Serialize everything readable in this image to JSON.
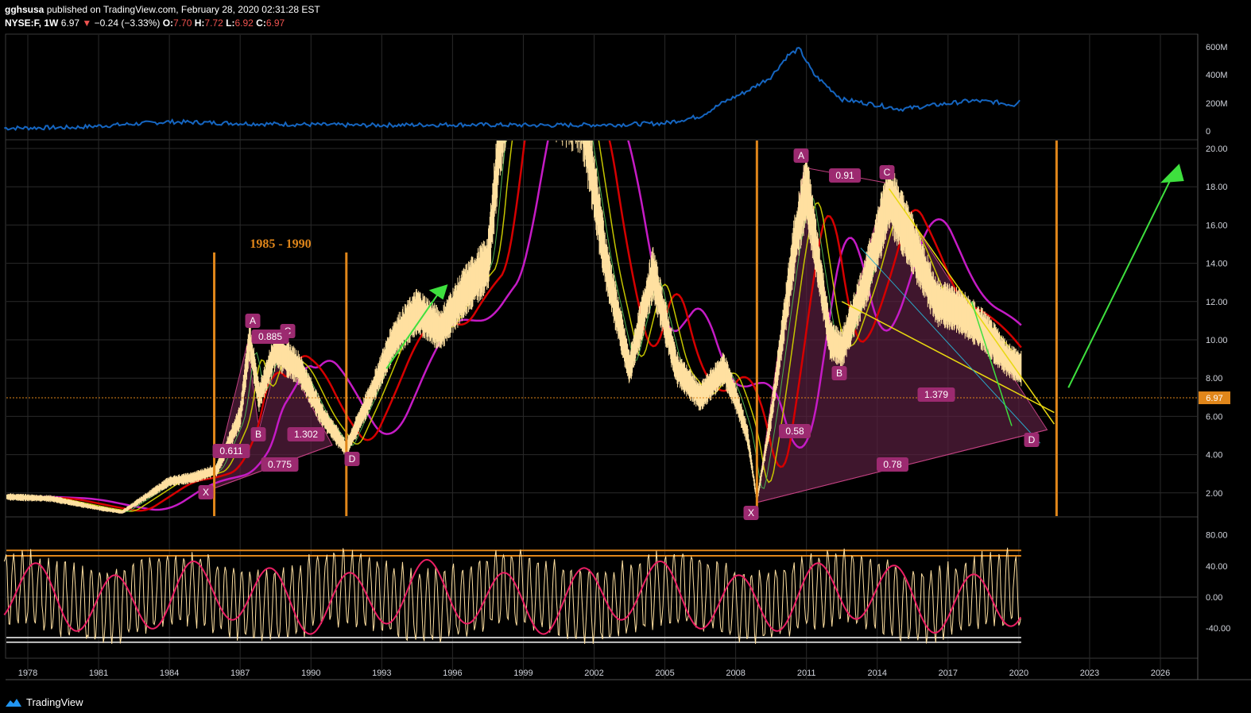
{
  "header": {
    "user": "gghsusa",
    "published": "published on TradingView.com, February 28, 2020 02:31:28 EST",
    "symbol": "NYSE:F, 1W",
    "last": "6.97",
    "change": "−0.24 (−3.33%)",
    "o_label": "O:",
    "o": "7.70",
    "h_label": "H:",
    "h": "7.72",
    "l_label": "L:",
    "l": "6.92",
    "c_label": "C:",
    "c": "6.97"
  },
  "footer": {
    "brand": "TradingView"
  },
  "colors": {
    "volume": "#1565c0",
    "ma_red": "#d50000",
    "ma_magenta": "#c51bc5",
    "ma_yellow": "#c6c600",
    "ma_green": "#4caf50",
    "candle": "#ffe0a0",
    "grid": "#2a2a2a",
    "orange": "#e0861a",
    "pattern_fill": "#5a2040",
    "label_bg": "#9c2a70",
    "osc_fast": "#ffe0a0",
    "osc_slow": "#e91e63",
    "arrow": "#3ee03e",
    "price_line": "#e0861a",
    "trend_yellow": "#e8d810",
    "trend_cyan": "#2aa8c8"
  },
  "chart_data": [
    {
      "type": "area",
      "name": "volume-pane",
      "y_ticks": [
        "600M",
        "400M",
        "200M",
        "0"
      ],
      "ylim": [
        0,
        620
      ],
      "unit": "M",
      "x": [
        1977,
        1980,
        1984,
        1988,
        1992,
        1996,
        2000,
        2003,
        2005,
        2006.5,
        2007.5,
        2008.5,
        2009.5,
        2010.2,
        2010.7,
        2011.3,
        2012.5,
        2014,
        2015,
        2016,
        2017,
        2018,
        2019,
        2019.8,
        2020.1
      ],
      "values": [
        15,
        20,
        60,
        45,
        35,
        40,
        35,
        40,
        50,
        100,
        200,
        280,
        380,
        530,
        580,
        400,
        220,
        180,
        150,
        170,
        190,
        210,
        200,
        180,
        230
      ]
    },
    {
      "type": "line",
      "name": "price-pane",
      "y_ticks": [
        "20.00",
        "18.00",
        "16.00",
        "14.00",
        "12.00",
        "10.00",
        "8.00",
        "6.00",
        "4.00",
        "2.00"
      ],
      "x_ticks": [
        "1978",
        "1981",
        "1984",
        "1987",
        "1990",
        "1993",
        "1996",
        "1999",
        "2002",
        "2005",
        "2008",
        "2011",
        "2014",
        "2017",
        "2020",
        "2023",
        "2026"
      ],
      "ylim": [
        0.2,
        20.5
      ],
      "xlim": [
        1977.1,
        2027.6
      ],
      "last_price": "6.97",
      "series": [
        {
          "x": [
            1977,
            1979,
            1981,
            1982,
            1983,
            1984,
            1985,
            1986,
            1987,
            1987.4,
            1987.8,
            1988.5,
            1989.5,
            1990.5,
            1991.5,
            1992.5,
            1993.5,
            1994.5,
            1995.5,
            1996.5,
            1997.5,
            1998,
            1998.5,
            2001.5,
            2002,
            2002.5,
            2003.5,
            2004.5,
            2005.5,
            2006.5,
            2007.5,
            2008,
            2008.5,
            2008.9,
            2009.5,
            2010.5,
            2011,
            2011.5,
            2012,
            2012.5,
            2013.5,
            2014.5,
            2015.5,
            2016.5,
            2017.5,
            2018.5,
            2019.5,
            2020.1
          ],
          "values": [
            1.8,
            1.7,
            1.2,
            1.0,
            1.8,
            2.6,
            2.8,
            3.2,
            6.0,
            10.0,
            7.0,
            9.5,
            8.5,
            6.0,
            4.3,
            7.0,
            10.0,
            11.5,
            10.5,
            12.5,
            14.0,
            20.5,
            24.0,
            22.0,
            18.0,
            14.0,
            8.5,
            13.5,
            8.5,
            7.0,
            8.5,
            7.0,
            5.0,
            1.6,
            6.0,
            15.0,
            18.0,
            14.0,
            10.0,
            9.5,
            13.0,
            17.5,
            15.0,
            12.0,
            11.5,
            10.5,
            9.0,
            8.5
          ]
        }
      ],
      "labels": {
        "period": "1985 - 1990",
        "pattern1": [
          "X",
          "A",
          "B",
          "C",
          "D",
          "0.611",
          "0.885",
          "0.775",
          "1.302"
        ],
        "pattern2": [
          "X",
          "A",
          "B",
          "C",
          "D",
          "0.91",
          "0.58",
          "0.78",
          "1.379"
        ]
      }
    },
    {
      "type": "line",
      "name": "oscillator-pane",
      "y_ticks": [
        "80.00",
        "40.00",
        "0.00",
        "-40.00"
      ],
      "ylim": [
        -70,
        90
      ],
      "levels": [
        60,
        53,
        -52,
        -58
      ]
    }
  ]
}
